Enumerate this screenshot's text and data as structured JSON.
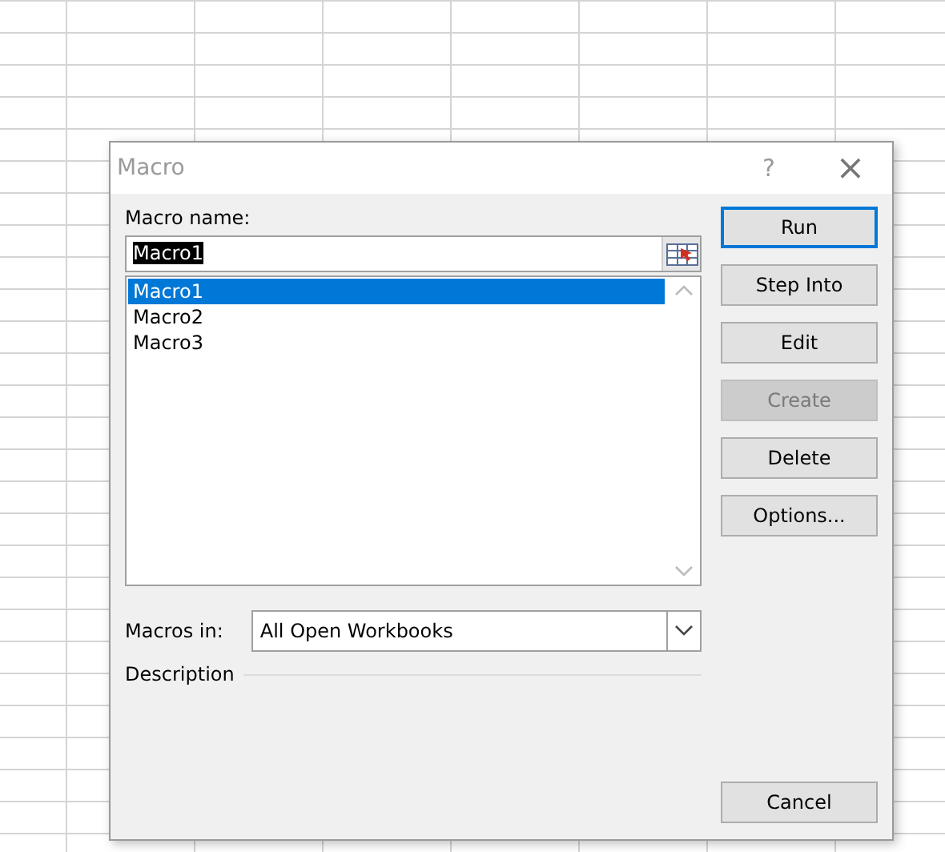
{
  "window": {
    "title": "Macro",
    "help": "?",
    "close": "×"
  },
  "macro_name": {
    "label": "Macro name:",
    "value": "Macro1"
  },
  "macros": [
    {
      "name": "Macro1",
      "selected": true
    },
    {
      "name": "Macro2",
      "selected": false
    },
    {
      "name": "Macro3",
      "selected": false
    }
  ],
  "buttons": [
    {
      "label": "Run",
      "default": true,
      "disabled": false
    },
    {
      "label": "Step Into",
      "default": false,
      "disabled": false
    },
    {
      "label": "Edit",
      "default": false,
      "disabled": false
    },
    {
      "label": "Create",
      "default": false,
      "disabled": true
    },
    {
      "label": "Delete",
      "default": false,
      "disabled": false
    },
    {
      "label": "Options...",
      "default": false,
      "disabled": false
    }
  ],
  "macros_in": {
    "label": "Macros in:",
    "value": "All Open Workbooks"
  },
  "description": {
    "label": "Description"
  },
  "cancel": {
    "label": "Cancel"
  }
}
